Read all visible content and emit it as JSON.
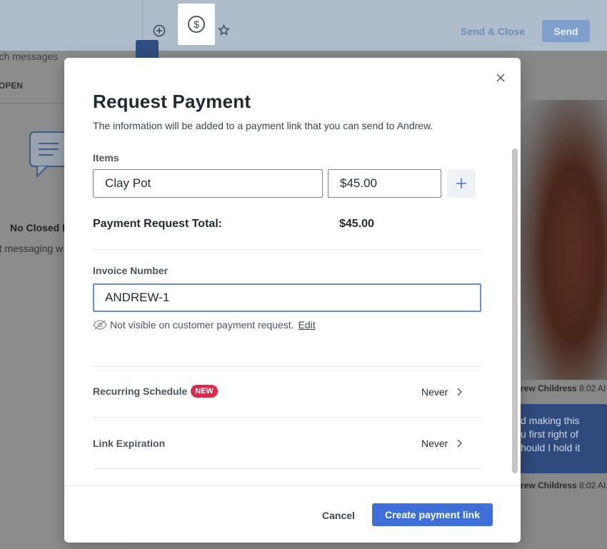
{
  "background": {
    "toolbar": {
      "icons": [
        "add-circle-icon",
        "dollar-circle-icon",
        "star-settings-icon"
      ],
      "send_close_label": "Send & Close",
      "send_label": "Send"
    },
    "sidebar": {
      "search_placeholder": "rch messages",
      "tab_open": "OPEN",
      "empty_title": "No Closed M",
      "empty_text": "rt messaging w"
    },
    "chat": {
      "sender": "rew Childress",
      "time1": "8:02 AI",
      "time2": "8:02 AI",
      "bubble_lines": [
        "d making this",
        "u first right of",
        "hould I hold it"
      ]
    }
  },
  "modal": {
    "title": "Request Payment",
    "subtitle": "The information will be added to a payment link that you can send to Andrew.",
    "items_label": "Items",
    "item_name": "Clay Pot",
    "item_price": "$45.00",
    "total_label": "Payment Request Total:",
    "total_value": "$45.00",
    "invoice_label": "Invoice Number",
    "invoice_value": "ANDREW-1",
    "invoice_hint": "Not visible on customer payment request.",
    "invoice_hint_edit": "Edit",
    "recurring_label": "Recurring Schedule",
    "recurring_badge": "NEW",
    "recurring_value": "Never",
    "expiration_label": "Link Expiration",
    "expiration_value": "Never",
    "cancel_label": "Cancel",
    "create_label": "Create payment link"
  },
  "colors": {
    "primary": "#3e6fd8",
    "badge": "#e0284a",
    "focus_border": "#6b8fd1"
  }
}
